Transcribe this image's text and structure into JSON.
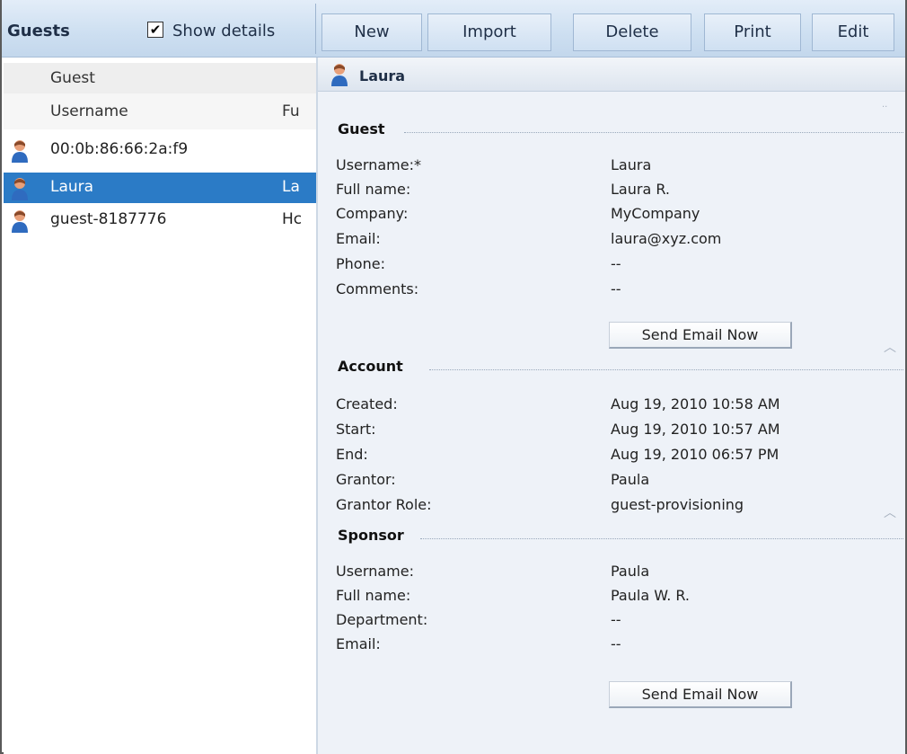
{
  "toolbar": {
    "title": "Guests",
    "show_details_label": "Show details",
    "show_details_checked": true,
    "buttons": [
      "New",
      "Import",
      "Delete",
      "Print",
      "Edit"
    ]
  },
  "list": {
    "group_header": "Guest",
    "columns": [
      "Username",
      "Fu"
    ],
    "rows": [
      {
        "username": "00:0b:86:66:2a:f9",
        "full": "",
        "selected": false
      },
      {
        "username": "Laura",
        "full": "La",
        "selected": true
      },
      {
        "username": "guest-8187776",
        "full": "Hc",
        "selected": false
      }
    ]
  },
  "detail": {
    "title": "Laura",
    "sections": {
      "guest": {
        "title": "Guest",
        "fields": [
          {
            "label": "Username:*",
            "value": "Laura"
          },
          {
            "label": "Full name:",
            "value": "Laura R."
          },
          {
            "label": "Company:",
            "value": "MyCompany"
          },
          {
            "label": "Email:",
            "value": "laura@xyz.com"
          },
          {
            "label": "Phone:",
            "value": "--"
          },
          {
            "label": "Comments:",
            "value": "--"
          }
        ],
        "button": "Send Email Now"
      },
      "account": {
        "title": "Account",
        "fields": [
          {
            "label": "Created:",
            "value": "Aug 19, 2010 10:58 AM"
          },
          {
            "label": "Start:",
            "value": "Aug 19, 2010 10:57 AM"
          },
          {
            "label": "End:",
            "value": "Aug 19, 2010 06:57 PM"
          },
          {
            "label": "Grantor:",
            "value": "Paula"
          },
          {
            "label": "Grantor Role:",
            "value": "guest-provisioning"
          }
        ]
      },
      "sponsor": {
        "title": "Sponsor",
        "fields": [
          {
            "label": "Username:",
            "value": "Paula"
          },
          {
            "label": "Full name:",
            "value": "Paula W. R."
          },
          {
            "label": "Department:",
            "value": "--"
          },
          {
            "label": "Email:",
            "value": "--"
          }
        ],
        "button": "Send Email Now"
      }
    }
  }
}
